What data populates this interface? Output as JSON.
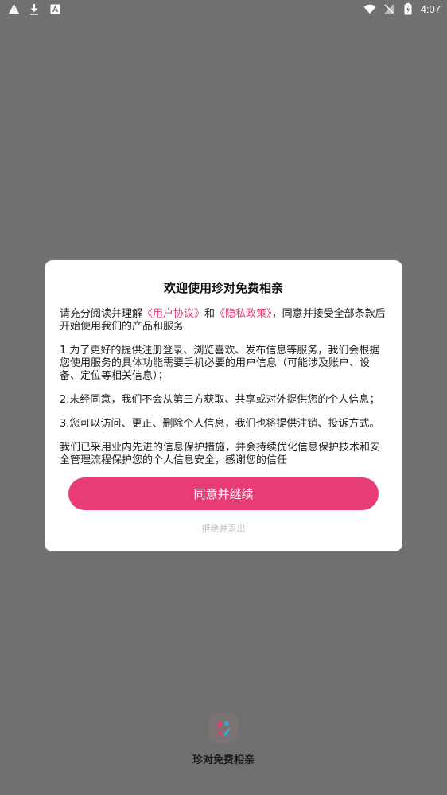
{
  "status_bar": {
    "time": "4:07",
    "left_icons": [
      "warning-icon",
      "download-icon",
      "a-icon"
    ],
    "right_icons": [
      "wifi-icon",
      "signal-icon",
      "battery-icon"
    ]
  },
  "dialog": {
    "title": "欢迎使用珍对免费相亲",
    "intro_prefix": "请充分阅读并理解",
    "user_agreement_link": "《用户协议》",
    "intro_and": "和",
    "privacy_policy_link": "《隐私政策》",
    "intro_suffix": "，同意并接受全部条款后开始使用我们的产品和服务",
    "item1": "1.为了更好的提供注册登录、浏览喜欢、发布信息等服务，我们会根据您使用服务的具体功能需要手机必要的用户信息（可能涉及账户、设备、定位等相关信息）；",
    "item2": "2.未经同意，我们不会从第三方获取、共享或对外提供您的个人信息；",
    "item3": "3.您可以访问、更正、删除个人信息，我们也将提供注销、投诉方式。",
    "closing": "我们已采用业内先进的信息保护措施，并会持续优化信息保护技术和安全管理流程保护您的个人信息安全，感谢您的信任",
    "agree_button": "同意并继续",
    "reject_button": "拒绝并退出"
  },
  "splash": {
    "app_name": "珍对免费相亲"
  },
  "colors": {
    "accent": "#e83d74",
    "overlay": "#707070"
  }
}
